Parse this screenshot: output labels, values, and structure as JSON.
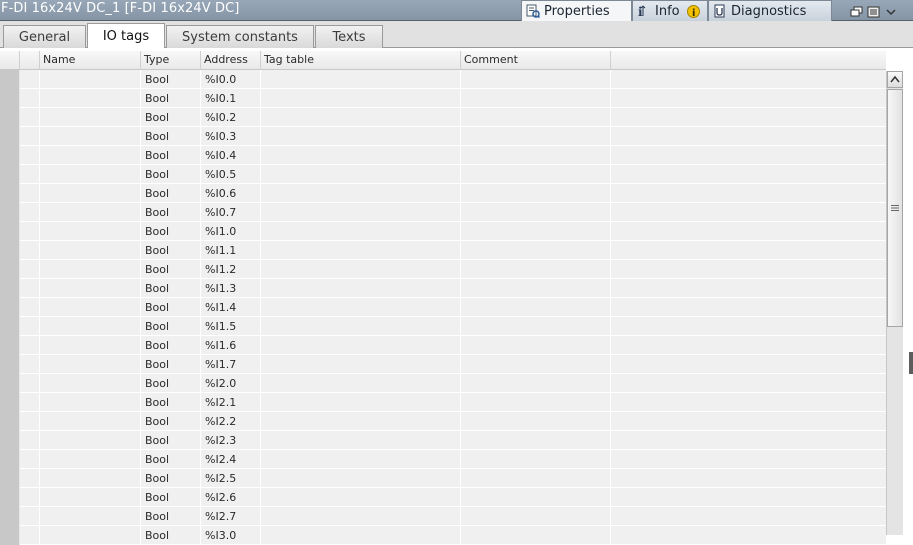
{
  "window": {
    "title": "F-DI 16x24V DC_1 [F-DI 16x24V DC]"
  },
  "top_tabs": [
    {
      "label": "Properties",
      "icon": "properties-icon",
      "active": true
    },
    {
      "label": "Info",
      "icon": "info-icon",
      "badge": "warning-badge-icon",
      "active": false
    },
    {
      "label": "Diagnostics",
      "icon": "diagnostics-icon",
      "active": false
    }
  ],
  "sub_tabs": [
    {
      "label": "General",
      "active": false
    },
    {
      "label": "IO tags",
      "active": true
    },
    {
      "label": "System constants",
      "active": false
    },
    {
      "label": "Texts",
      "active": false
    }
  ],
  "table": {
    "columns": [
      "Name",
      "Type",
      "Address",
      "Tag table",
      "Comment"
    ],
    "rows": [
      {
        "name": "",
        "type": "Bool",
        "address": "%I0.0",
        "tag_table": "",
        "comment": ""
      },
      {
        "name": "",
        "type": "Bool",
        "address": "%I0.1",
        "tag_table": "",
        "comment": ""
      },
      {
        "name": "",
        "type": "Bool",
        "address": "%I0.2",
        "tag_table": "",
        "comment": ""
      },
      {
        "name": "",
        "type": "Bool",
        "address": "%I0.3",
        "tag_table": "",
        "comment": ""
      },
      {
        "name": "",
        "type": "Bool",
        "address": "%I0.4",
        "tag_table": "",
        "comment": ""
      },
      {
        "name": "",
        "type": "Bool",
        "address": "%I0.5",
        "tag_table": "",
        "comment": ""
      },
      {
        "name": "",
        "type": "Bool",
        "address": "%I0.6",
        "tag_table": "",
        "comment": ""
      },
      {
        "name": "",
        "type": "Bool",
        "address": "%I0.7",
        "tag_table": "",
        "comment": ""
      },
      {
        "name": "",
        "type": "Bool",
        "address": "%I1.0",
        "tag_table": "",
        "comment": ""
      },
      {
        "name": "",
        "type": "Bool",
        "address": "%I1.1",
        "tag_table": "",
        "comment": ""
      },
      {
        "name": "",
        "type": "Bool",
        "address": "%I1.2",
        "tag_table": "",
        "comment": ""
      },
      {
        "name": "",
        "type": "Bool",
        "address": "%I1.3",
        "tag_table": "",
        "comment": ""
      },
      {
        "name": "",
        "type": "Bool",
        "address": "%I1.4",
        "tag_table": "",
        "comment": ""
      },
      {
        "name": "",
        "type": "Bool",
        "address": "%I1.5",
        "tag_table": "",
        "comment": ""
      },
      {
        "name": "",
        "type": "Bool",
        "address": "%I1.6",
        "tag_table": "",
        "comment": ""
      },
      {
        "name": "",
        "type": "Bool",
        "address": "%I1.7",
        "tag_table": "",
        "comment": ""
      },
      {
        "name": "",
        "type": "Bool",
        "address": "%I2.0",
        "tag_table": "",
        "comment": ""
      },
      {
        "name": "",
        "type": "Bool",
        "address": "%I2.1",
        "tag_table": "",
        "comment": ""
      },
      {
        "name": "",
        "type": "Bool",
        "address": "%I2.2",
        "tag_table": "",
        "comment": ""
      },
      {
        "name": "",
        "type": "Bool",
        "address": "%I2.3",
        "tag_table": "",
        "comment": ""
      },
      {
        "name": "",
        "type": "Bool",
        "address": "%I2.4",
        "tag_table": "",
        "comment": ""
      },
      {
        "name": "",
        "type": "Bool",
        "address": "%I2.5",
        "tag_table": "",
        "comment": ""
      },
      {
        "name": "",
        "type": "Bool",
        "address": "%I2.6",
        "tag_table": "",
        "comment": ""
      },
      {
        "name": "",
        "type": "Bool",
        "address": "%I2.7",
        "tag_table": "",
        "comment": ""
      },
      {
        "name": "",
        "type": "Bool",
        "address": "%I3.0",
        "tag_table": "",
        "comment": ""
      }
    ]
  },
  "colors": {
    "titlebar": "#8b9bac",
    "row_bg": "#f0f0f0",
    "warning": "#f2c200"
  }
}
